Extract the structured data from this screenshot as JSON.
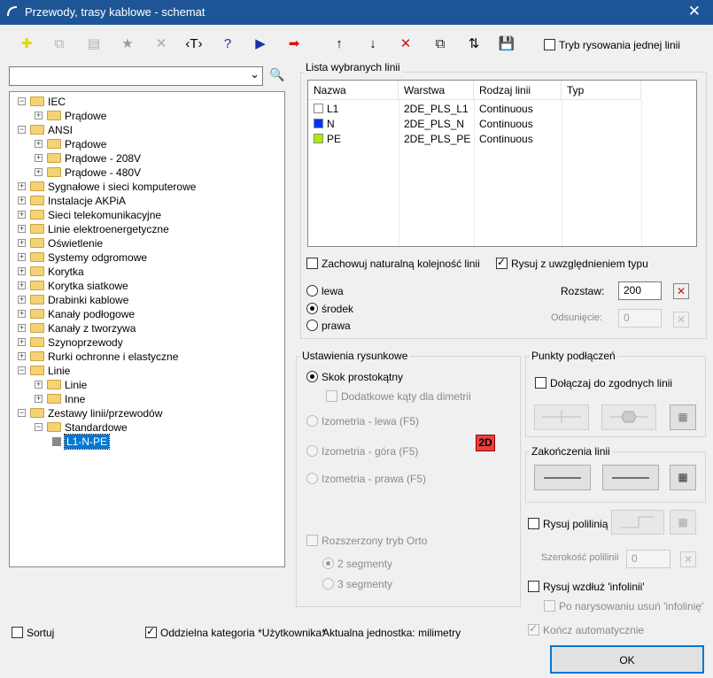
{
  "window": {
    "title": "Przewody, trasy kablowe - schemat",
    "close_glyph": "✕"
  },
  "toolbar": {
    "buttons": [
      {
        "name": "add",
        "glyph": "✚",
        "color": "#e8d200"
      },
      {
        "name": "copy",
        "glyph": "⧉",
        "color": "#b0b0b0"
      },
      {
        "name": "properties",
        "glyph": "▤",
        "color": "#b0b0b0"
      },
      {
        "name": "favorite",
        "glyph": "★",
        "color": "#9a9a9a"
      },
      {
        "name": "delete",
        "glyph": "✕",
        "color": "#aaaaaa"
      },
      {
        "name": "text",
        "glyph": "‹T›",
        "color": "#000000"
      },
      {
        "name": "help",
        "glyph": "?",
        "color": "#1a2fa8"
      },
      {
        "name": "play",
        "glyph": "▶",
        "color": "#1a2fa8"
      },
      {
        "name": "insert-arrow",
        "glyph": "➡",
        "color": "#e01010"
      },
      {
        "name": "move-up",
        "glyph": "↑",
        "color": "#000000"
      },
      {
        "name": "move-down",
        "glyph": "↓",
        "color": "#000000"
      },
      {
        "name": "remove",
        "glyph": "✕",
        "color": "#d01010"
      },
      {
        "name": "duplicate",
        "glyph": "⧉",
        "color": "#222222"
      },
      {
        "name": "sort",
        "glyph": "⇅",
        "color": "#000000"
      },
      {
        "name": "save",
        "glyph": "💾",
        "color": "#000000"
      }
    ],
    "single_line_mode": "Tryb rysowania jednej linii"
  },
  "search": {
    "value": "",
    "dropdown_glyph": "⌄",
    "icon_glyph": "🔍"
  },
  "tree": {
    "nodes": [
      {
        "label": "IEC",
        "level": 0,
        "exp": "−"
      },
      {
        "label": "Prądowe",
        "level": 1,
        "exp": "+"
      },
      {
        "label": "ANSI",
        "level": 0,
        "exp": "−"
      },
      {
        "label": "Prądowe",
        "level": 1,
        "exp": "+"
      },
      {
        "label": "Prądowe - 208V",
        "level": 1,
        "exp": "+"
      },
      {
        "label": "Prądowe - 480V",
        "level": 1,
        "exp": "+"
      },
      {
        "label": "Sygnałowe i sieci komputerowe",
        "level": 0,
        "exp": "+"
      },
      {
        "label": "Instalacje AKPiA",
        "level": 0,
        "exp": "+"
      },
      {
        "label": "Sieci telekomunikacyjne",
        "level": 0,
        "exp": "+"
      },
      {
        "label": "Linie elektroenergetyczne",
        "level": 0,
        "exp": "+"
      },
      {
        "label": "Oświetlenie",
        "level": 0,
        "exp": "+"
      },
      {
        "label": "Systemy odgromowe",
        "level": 0,
        "exp": "+"
      },
      {
        "label": "Korytka",
        "level": 0,
        "exp": "+"
      },
      {
        "label": "Korytka siatkowe",
        "level": 0,
        "exp": "+"
      },
      {
        "label": "Drabinki kablowe",
        "level": 0,
        "exp": "+"
      },
      {
        "label": "Kanały podłogowe",
        "level": 0,
        "exp": "+"
      },
      {
        "label": "Kanały z tworzywa",
        "level": 0,
        "exp": "+"
      },
      {
        "label": "Szynoprzewody",
        "level": 0,
        "exp": "+"
      },
      {
        "label": "Rurki ochronne i elastyczne",
        "level": 0,
        "exp": "+"
      },
      {
        "label": "Linie",
        "level": 0,
        "exp": "−"
      },
      {
        "label": "Linie",
        "level": 1,
        "exp": "+"
      },
      {
        "label": "Inne",
        "level": 1,
        "exp": "+"
      },
      {
        "label": "Zestawy linii/przewodów",
        "level": 0,
        "exp": "−"
      },
      {
        "label": "Standardowe",
        "level": 1,
        "exp": "−"
      },
      {
        "label": "L1-N-PE",
        "level": 2,
        "exp": "",
        "selected": true
      }
    ]
  },
  "selected_lines": {
    "group_label": "Lista wybranych linii",
    "columns": [
      "Nazwa",
      "Warstwa",
      "Rodzaj linii",
      "Typ"
    ],
    "rows": [
      {
        "name": "L1",
        "layer": "2DE_PLS_L1",
        "linetype": "Continuous",
        "type": "",
        "color": "#ffffff"
      },
      {
        "name": "N",
        "layer": "2DE_PLS_N",
        "linetype": "Continuous",
        "type": "",
        "color": "#0033ff"
      },
      {
        "name": "PE",
        "layer": "2DE_PLS_PE",
        "linetype": "Continuous",
        "type": "",
        "color": "#aaee00"
      }
    ],
    "natural_order": "Zachowuj naturalną kolejność linii",
    "draw_with_type": "Rysuj z uwzględnieniem typu",
    "pos_left": "lewa",
    "pos_center": "środek",
    "pos_right": "prawa",
    "spacing_label": "Rozstaw:",
    "spacing_value": "200",
    "offset_label": "Odsunięcie:",
    "offset_value": "0"
  },
  "drawing": {
    "group_label": "Ustawienia rysunkowe",
    "rect_jump": "Skok prostokątny",
    "extra_angles": "Dodatkowe kąty dla dimetrii",
    "iso_left": "Izometria - lewa (F5)",
    "iso_top": "Izometria - góra (F5)",
    "iso_right": "Izometria - prawa (F5)",
    "badge": "2D",
    "ortho": "Rozszerzony tryb Orto",
    "seg2": "2 segmenty",
    "seg3": "3 segmenty"
  },
  "connection_points": {
    "group_label": "Punkty podłączeń",
    "join_matching": "Dołączaj do zgodnych linii"
  },
  "line_endings": {
    "group_label": "Zakończenia linii"
  },
  "polyline": {
    "draw": "Rysuj polilinią",
    "width_label": "Szerokość polilinii",
    "width_value": "0"
  },
  "infoline": {
    "draw": "Rysuj wzdłuż 'infolinii'",
    "remove_after": "Po narysowaniu usuń 'infolinię'",
    "auto_finish": "Kończ automatycznie"
  },
  "footer": {
    "sort": "Sortuj",
    "separate_category": "Oddzielna kategoria *Użytkownika*",
    "units": "Aktualna jednostka: milimetry",
    "ok": "OK"
  },
  "colors": {
    "titlebar": "#1e5597",
    "selection": "#0078d7",
    "badge": "#e03030"
  }
}
